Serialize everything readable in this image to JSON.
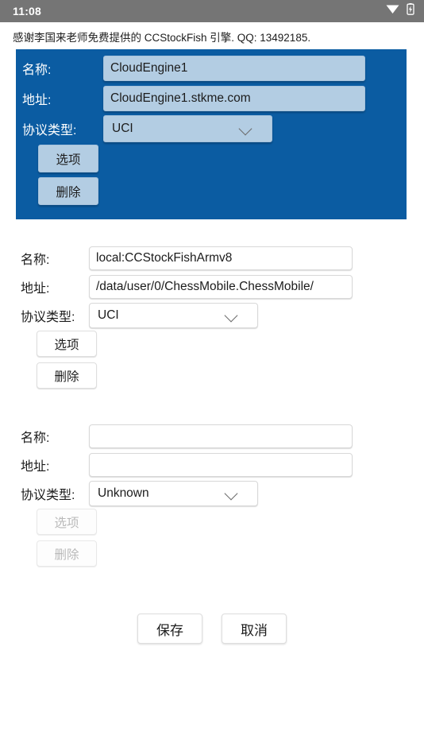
{
  "statusbar": {
    "time": "11:08",
    "icons": [
      "wifi-icon",
      "battery-charging-icon"
    ],
    "background": "#757575"
  },
  "header": {
    "note": "感谢李国来老师免费提供的 CCStockFish 引擎. QQ: 13492185."
  },
  "labels": {
    "name": "名称:",
    "address": "地址:",
    "protocol": "协议类型:",
    "options": "选项",
    "delete": "删除"
  },
  "theme": {
    "selected_background": "#0b5ca2",
    "selected_field_background": "#b3cde3",
    "selected_label_color": "#ffffff"
  },
  "engines": [
    {
      "selected": true,
      "name_value": "CloudEngine1",
      "address_value": "CloudEngine1.stkme.com",
      "protocol_value": "UCI",
      "options_label": "选项",
      "delete_label": "删除",
      "options_disabled": false,
      "delete_disabled": false
    },
    {
      "selected": false,
      "name_value": "local:CCStockFishArmv8",
      "address_value": "/data/user/0/ChessMobile.ChessMobile/",
      "protocol_value": "UCI",
      "options_label": "选项",
      "delete_label": "删除",
      "options_disabled": false,
      "delete_disabled": false
    },
    {
      "selected": false,
      "name_value": "",
      "address_value": "",
      "protocol_value": "Unknown",
      "options_label": "选项",
      "delete_label": "删除",
      "options_disabled": true,
      "delete_disabled": true
    }
  ],
  "footer": {
    "save_label": "保存",
    "cancel_label": "取消"
  }
}
